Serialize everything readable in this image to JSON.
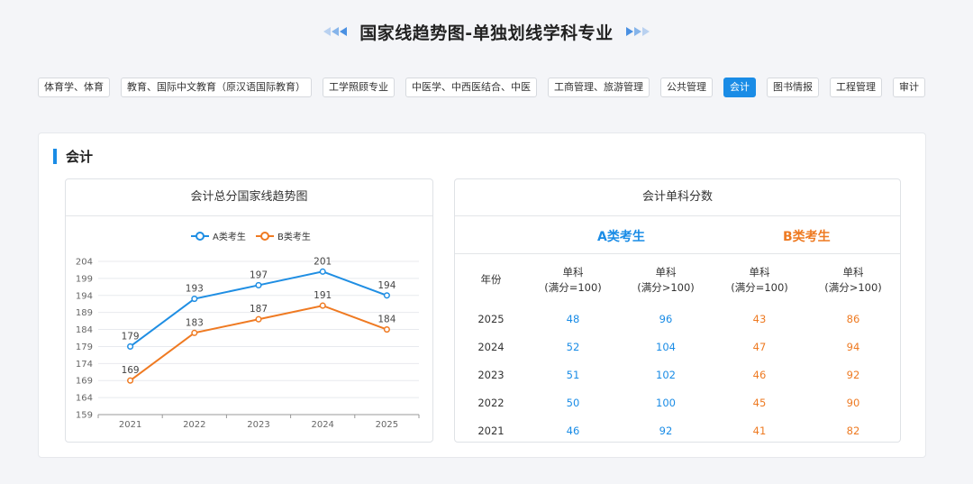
{
  "header": {
    "title": "国家线趋势图-单独划线学科专业"
  },
  "tabs": [
    "体育学、体育",
    "教育、国际中文教育（原汉语国际教育）",
    "工学照顾专业",
    "中医学、中西医结合、中医",
    "工商管理、旅游管理",
    "公共管理",
    "会计",
    "图书情报",
    "工程管理",
    "审计"
  ],
  "active_tab": "会计",
  "section": {
    "title": "会计"
  },
  "chart_panel": {
    "title": "会计总分国家线趋势图"
  },
  "chart_data": {
    "type": "line",
    "x": [
      "2021",
      "2022",
      "2023",
      "2024",
      "2025"
    ],
    "series": [
      {
        "name": "A类考生",
        "values": [
          179,
          193,
          197,
          201,
          194
        ],
        "color": "#1f8ee3"
      },
      {
        "name": "B类考生",
        "values": [
          169,
          183,
          187,
          191,
          184
        ],
        "color": "#ef7a22"
      }
    ],
    "ylim": [
      159,
      204
    ],
    "yticks": [
      159,
      164,
      169,
      174,
      179,
      184,
      189,
      194,
      199,
      204
    ],
    "legend": "top-center",
    "grid": true,
    "data_labels": true
  },
  "table_panel": {
    "title": "会计单科分数",
    "group_a": "A类考生",
    "group_b": "B类考生",
    "col_year": "年份",
    "col_s100_1": "单科",
    "col_s100_2": "(满分=100)",
    "col_sgt100_1": "单科",
    "col_sgt100_2": "(满分>100)",
    "rows": [
      {
        "year": "2025",
        "a1": "48",
        "a2": "96",
        "b1": "43",
        "b2": "86"
      },
      {
        "year": "2024",
        "a1": "52",
        "a2": "104",
        "b1": "47",
        "b2": "94"
      },
      {
        "year": "2023",
        "a1": "51",
        "a2": "102",
        "b1": "46",
        "b2": "92"
      },
      {
        "year": "2022",
        "a1": "50",
        "a2": "100",
        "b1": "45",
        "b2": "90"
      },
      {
        "year": "2021",
        "a1": "46",
        "a2": "92",
        "b1": "41",
        "b2": "82"
      }
    ]
  },
  "colors": {
    "accent": "#1a8ce6",
    "series_a": "#1f8ee3",
    "series_b": "#ef7a22"
  }
}
